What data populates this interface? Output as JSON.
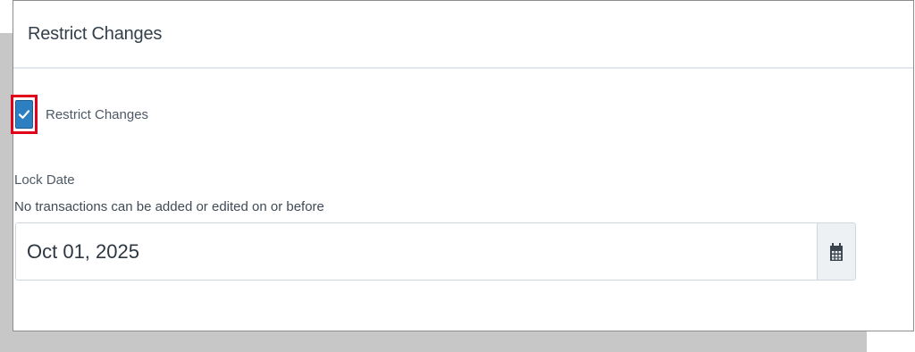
{
  "panel": {
    "title": "Restrict Changes"
  },
  "restrict_changes": {
    "label": "Restrict Changes",
    "checked": true
  },
  "lock_date": {
    "label": "Lock Date",
    "help_text": "No transactions can be added or edited on or before",
    "value": "Oct 01, 2025"
  },
  "icons": {
    "checkbox_check": "check-icon",
    "calendar": "calendar-icon"
  },
  "colors": {
    "checkbox_fill": "#2c7fc0",
    "highlight_border": "#e0001b"
  }
}
